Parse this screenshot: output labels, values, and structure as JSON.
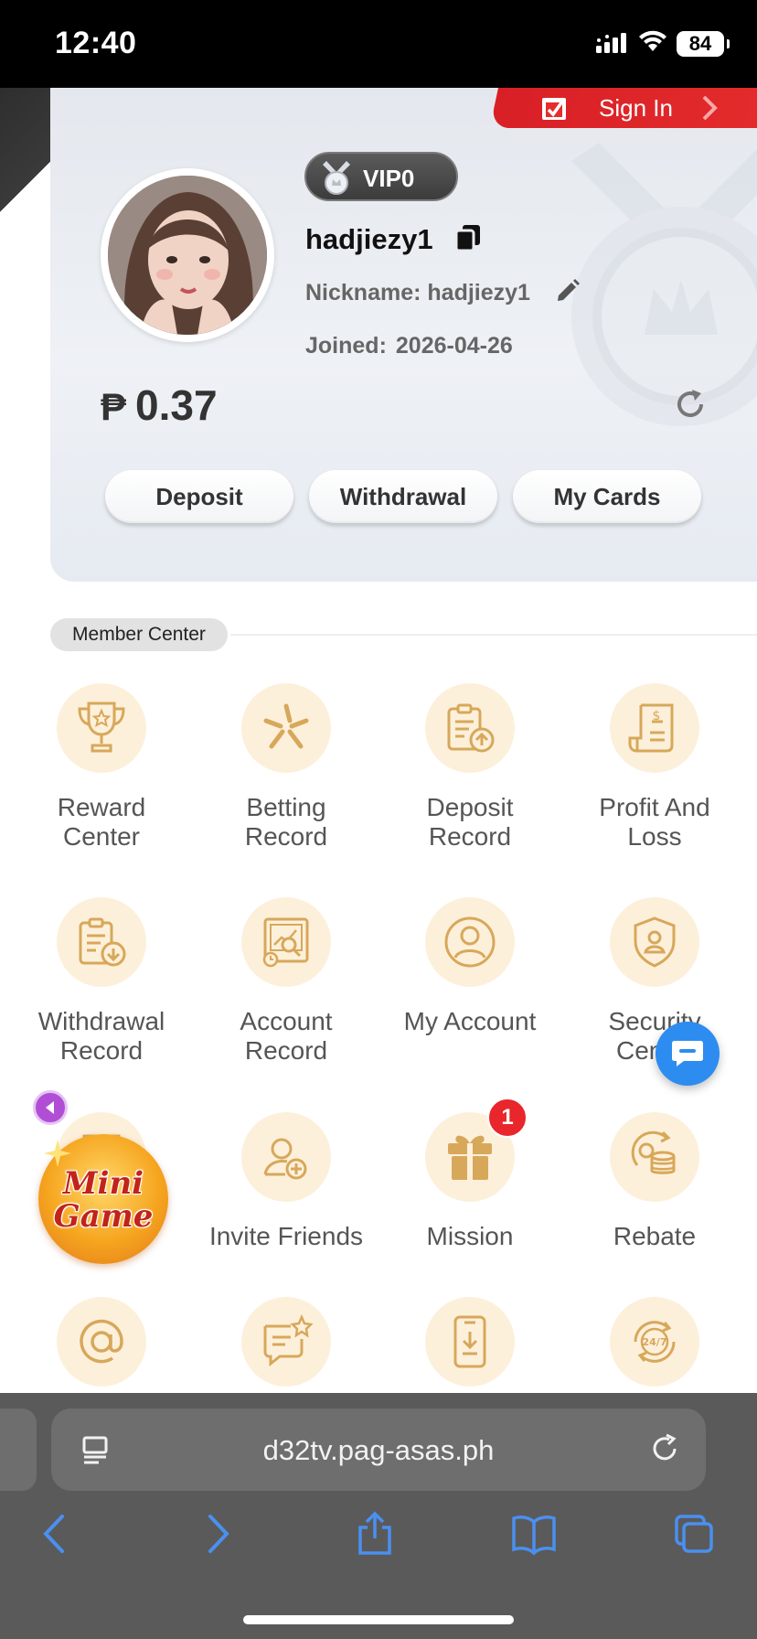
{
  "status_bar": {
    "time": "12:40",
    "battery": "84"
  },
  "signin": {
    "label": "Sign In"
  },
  "profile": {
    "vip_level": "VIP0",
    "username": "hadjiezy1",
    "nickname_label": "Nickname:",
    "nickname": "hadjiezy1",
    "joined_label": "Joined:",
    "joined_date": "2026-04-26",
    "currency": "₱",
    "balance": "0.37"
  },
  "actions": {
    "deposit": "Deposit",
    "withdrawal": "Withdrawal",
    "my_cards": "My Cards"
  },
  "member_center": {
    "title": "Member Center",
    "items": [
      {
        "label_1": "Reward",
        "label_2": "Center",
        "icon": "trophy-icon"
      },
      {
        "label_1": "Betting",
        "label_2": "Record",
        "icon": "betting-icon"
      },
      {
        "label_1": "Deposit",
        "label_2": "Record",
        "icon": "deposit-record-icon"
      },
      {
        "label_1": "Profit And",
        "label_2": "Loss",
        "icon": "profit-loss-icon"
      },
      {
        "label_1": "Withdrawal",
        "label_2": "Record",
        "icon": "withdrawal-record-icon"
      },
      {
        "label_1": "Account",
        "label_2": "Record",
        "icon": "account-record-icon"
      },
      {
        "label_1": "My Account",
        "label_2": "",
        "icon": "user-icon"
      },
      {
        "label_1": "Security",
        "label_2": "Center",
        "icon": "shield-user-icon"
      },
      {
        "label_1": "",
        "label_2": "",
        "icon": "store-icon"
      },
      {
        "label_1": "Invite Friends",
        "label_2": "",
        "icon": "invite-icon"
      },
      {
        "label_1": "Mission",
        "label_2": "",
        "icon": "gift-icon",
        "badge": "1"
      },
      {
        "label_1": "Rebate",
        "label_2": "",
        "icon": "coins-icon"
      },
      {
        "icon": "at-sign-icon"
      },
      {
        "icon": "feedback-icon"
      },
      {
        "icon": "download-app-icon"
      },
      {
        "icon": "support-24-7-icon"
      }
    ]
  },
  "floating": {
    "minigame_line1": "Mini",
    "minigame_line2": "Game"
  },
  "browser": {
    "url": "d32tv.pag-asas.ph"
  },
  "colors": {
    "accent_gold": "#d7a85a",
    "icon_bg": "#fdf0db",
    "signin_red": "#d81f26",
    "chat_blue": "#2d8cf0"
  }
}
